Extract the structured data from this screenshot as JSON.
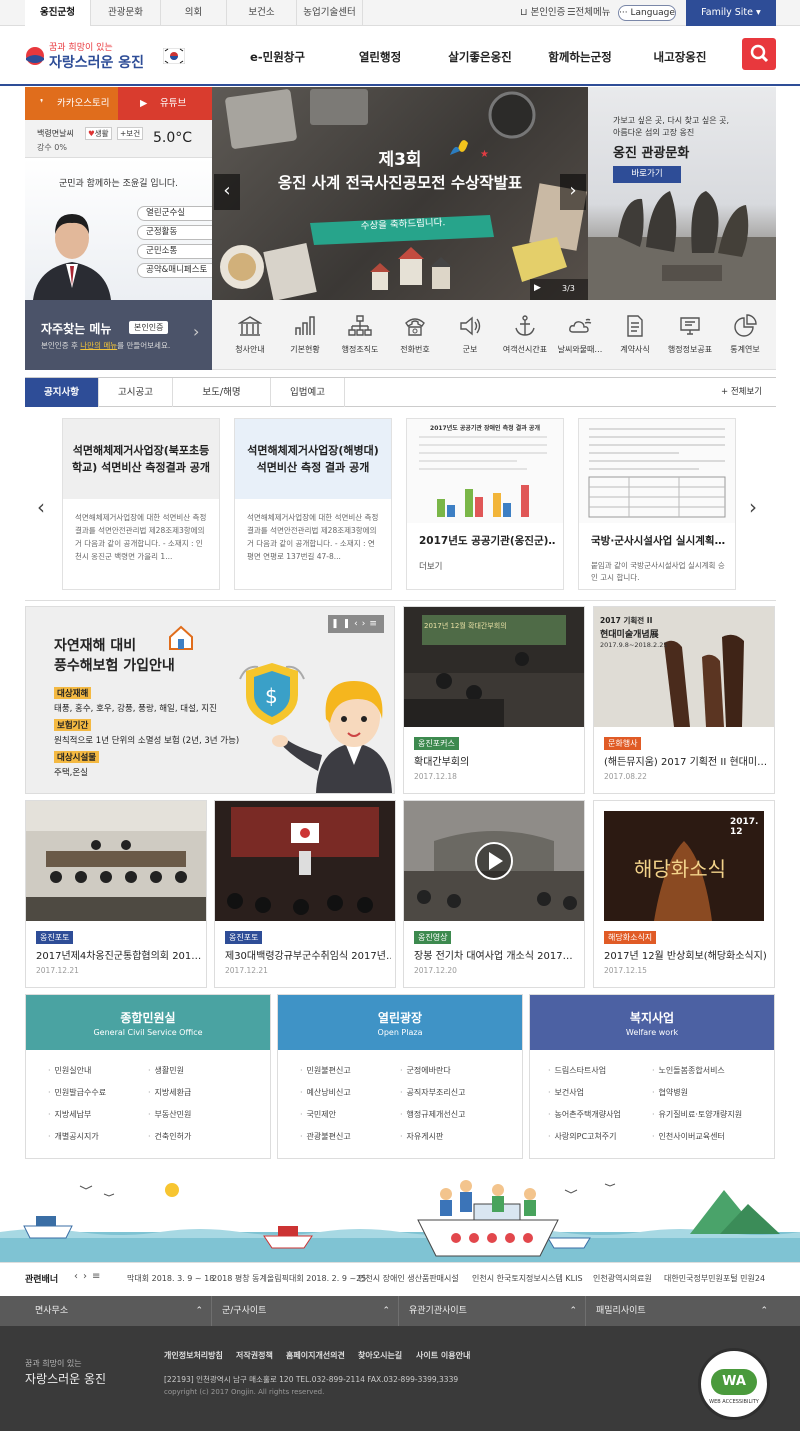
{
  "topbar": {
    "tabs": [
      "옹진군청",
      "관광문화",
      "의회",
      "보건소",
      "농업기술센터"
    ],
    "auth_label": "본인인증",
    "sitemap_label": "전체메뉴",
    "language_label": "··· Language",
    "family_label": "Family Site"
  },
  "header": {
    "logo_small": "꿈과 희망이 있는",
    "logo_big": "자랑스러운 옹진",
    "menu": [
      "e-민원창구",
      "열린행정",
      "살기좋은옹진",
      "함께하는군정",
      "내고장옹진"
    ]
  },
  "left": {
    "kakao_label": "카카오스토리",
    "youtube_label": "유튜브",
    "weather": {
      "location": "백령면날씨",
      "tag1": "생활",
      "tag2": "보건",
      "rain": "강수 0%",
      "temp": "5.0°C"
    },
    "greeting": "군민과 함께하는 조윤길 입니다.",
    "mayor_links": [
      "열린군수실",
      "군정활동",
      "군민소통",
      "공약&매니페스토"
    ],
    "fav_title": "자주찾는 메뉴",
    "fav_badge": "본인인증",
    "fav_desc_pre": "본인인증 후 ",
    "fav_desc_hl": "나만의 메뉴",
    "fav_desc_post": "를 만들어보세요."
  },
  "main_banner": {
    "line1": "제3회",
    "line2": "옹진 사계 전국사진공모전 수상작발표",
    "ribbon": "수상을 축하드립니다.",
    "pager": "3/3"
  },
  "tour_banner": {
    "text1": "가보고 싶은 곳, 다시 찾고 싶은 곳,",
    "text2": "아름다운 섬의 고장 옹진",
    "title": "옹진 관광문화",
    "button": "바로가기"
  },
  "quick_menu": [
    "청사안내",
    "기본현황",
    "행정조직도",
    "전화번호",
    "군보",
    "여객선시간표",
    "날씨와물때…",
    "계약사식",
    "행정정보공표",
    "통계연보"
  ],
  "notice": {
    "tabs": [
      "공지사항",
      "고시공고",
      "보도/해명",
      "입법예고"
    ],
    "more": "+ 전체보기",
    "cards": [
      {
        "head": "석면해체제거사업장(북포초등학교) 석면비산 측정결과 공개",
        "desc": "석면해체제거사업장에 대한 석면비산 측정결과를 석면안전관리법 제28조제3항에의거 다음과 같이 공개합니다. - 소재지 : 인천시 옹진군 백령면 가을리 1..."
      },
      {
        "head": "석면해체제거사업장(해병대) 석면비산 측정 결과 공개",
        "desc": "석면해체제거사업장에 대한 석면비산 측정결과를 석면안전관리법 제28조제3항에의거 다음과 같이 공개합니다. - 소재지 : 연평면 연평로 137번길 47-8..."
      },
      {
        "title": "2017년도 공공기관(옹진군)…",
        "desc": "더보기",
        "doc_title": "2017년도 공공기관 장애인 측정 결과 공개"
      },
      {
        "title": "국방·군사시설사업 실시계획…",
        "desc": "붙임과 같이 국방군사시설사업 실시계획 승인 고시 합니다."
      }
    ]
  },
  "promo": {
    "title1": "자연재해 대비",
    "title2": "풍수해보험 가입안내",
    "label1": "대상재해",
    "text1": "태풍, 홍수, 호우, 강풍, 풍랑, 해일, 대설, 지진",
    "label2": "보험기간",
    "text2": "원칙적으로 1년 단위의 소멸성 보험 (2년, 3년 가능)",
    "label3": "대상시설물",
    "text3": "주택,온실"
  },
  "gallery_top": [
    {
      "tag": "옹진포커스",
      "title": "확대간부회의",
      "date": "2017.12.18",
      "img_text": "2017년 12월 확대간부회의"
    },
    {
      "tag": "문화행사",
      "title": "(해든뮤지움) 2017 기획전 II 현대미…",
      "date": "2017.08.22",
      "img_text1": "2017 기획전 II",
      "img_text2": "현대미술개념展",
      "img_text3": "2017.9.8~2018.2.25"
    }
  ],
  "gallery_bottom": [
    {
      "tag": "옹진포토",
      "title": "2017년제4차옹진군통합협의회 201…",
      "date": "2017.12.21"
    },
    {
      "tag": "옹진포토",
      "title": "제30대백령강규부군수취임식 2017년…",
      "date": "2017.12.21"
    },
    {
      "tag": "옹진영상",
      "title": "장봉 전기차 대여사업 개소식 2017…",
      "date": "2017.12.20"
    },
    {
      "tag": "해당화소식지",
      "title": "2017년 12월 반상회보(해당화소식지)",
      "date": "2017.12.15",
      "img_year": "2017. 12",
      "img_title": "해당화소식"
    }
  ],
  "services": [
    {
      "title": "종합민원실",
      "sub": "General Civil Service Office",
      "color": "#4aa3a2",
      "items": [
        "민원실안내",
        "생활민원",
        "민원발급수수료",
        "지방세환급",
        "지방세납부",
        "부동산민원",
        "개별공시지가",
        "건축인허가"
      ]
    },
    {
      "title": "열린광장",
      "sub": "Open Plaza",
      "color": "#3f93c6",
      "items": [
        "민원불편신고",
        "군정에바란다",
        "예산낭비신고",
        "공직자부조리신고",
        "국민제안",
        "행정규제개선신고",
        "관광불편신고",
        "자유게시판"
      ]
    },
    {
      "title": "복지사업",
      "sub": "Welfare work",
      "color": "#4c61a3",
      "items": [
        "드림스타트사업",
        "노인돌봄종합서비스",
        "보건사업",
        "협약병원",
        "농어촌주택개량사업",
        "유기질비료·토양개량지원",
        "사랑의PC고쳐주기",
        "인천사이버교육센터"
      ]
    }
  ],
  "related": {
    "title": "관련배너",
    "items": [
      "막대회 2018. 3. 9 ~ 18",
      "2018 평창 동계올림픽대회 2018. 2. 9 ~25",
      "인천시 장애인 생산품판매시설",
      "인천시 한국토지정보시스템 KLIS",
      "인천광역시의료원",
      "대한민국정부민원포털 민원24"
    ]
  },
  "sitebar": [
    "면사무소",
    "군/구사이트",
    "유관기관사이트",
    "패밀리사이트"
  ],
  "footer": {
    "links": [
      "개인정보처리방침",
      "저작권정책",
      "홈페이지개선의견",
      "찾아오시는길",
      "사이트 이용안내"
    ],
    "address": "[22193] 인천광역시 남구 매소홀로 120 TEL.032-899-2114 FAX.032-899-3399,3339",
    "copyright": "copyright (c) 2017 Ongjin. All rights reserved.",
    "logo_small": "꿈과 희망이 있는",
    "logo_big": "자랑스러운 옹진",
    "wa_label": "WA",
    "wa_ring": "WEB ACCESSIBILITY"
  },
  "colors": {
    "primary": "#2e4d97",
    "accent_red": "#e8383d",
    "kakao": "#e06d1c",
    "youtube": "#d93c2e",
    "tag_blue": "#2e4d97",
    "tag_green": "#3d8a4f",
    "tag_orange": "#e05b26"
  }
}
